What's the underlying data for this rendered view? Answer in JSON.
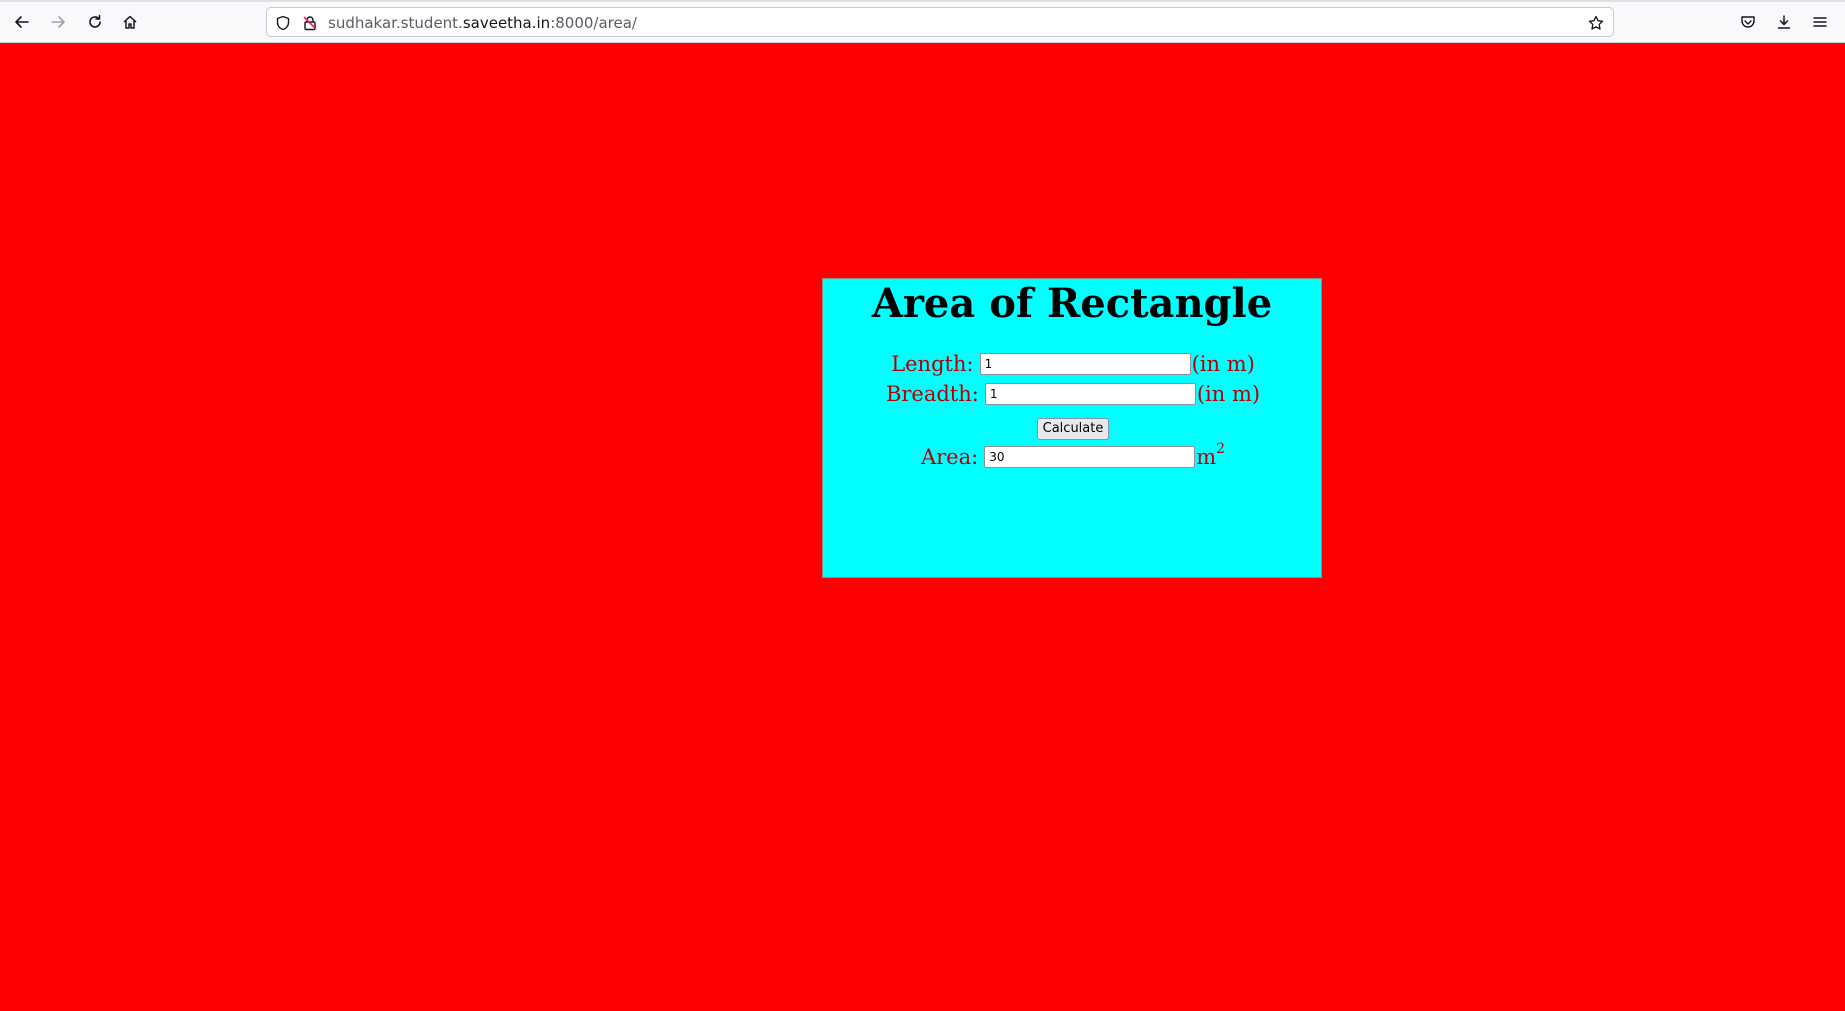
{
  "browser": {
    "url_prefix": "sudhakar.student.",
    "url_host": "saveetha.in",
    "url_suffix": ":8000/area/",
    "icons": [
      "back-icon",
      "forward-icon",
      "reload-icon",
      "home-icon",
      "shield-icon",
      "insecure-lock-icon",
      "bookmark-star-icon",
      "pocket-icon",
      "download-icon",
      "menu-icon"
    ]
  },
  "page": {
    "background": "#ff0000",
    "card_background": "#00ffff",
    "label_color": "#b30000",
    "title": "Area of Rectangle",
    "length": {
      "label": "Length:",
      "value": "1",
      "unit": "(in m)"
    },
    "breadth": {
      "label": "Breadth:",
      "value": "1",
      "unit": "(in m)"
    },
    "calculate_label": "Calculate",
    "area": {
      "label": "Area:",
      "value": "30",
      "unit": "m",
      "unit_sup": "2"
    }
  }
}
